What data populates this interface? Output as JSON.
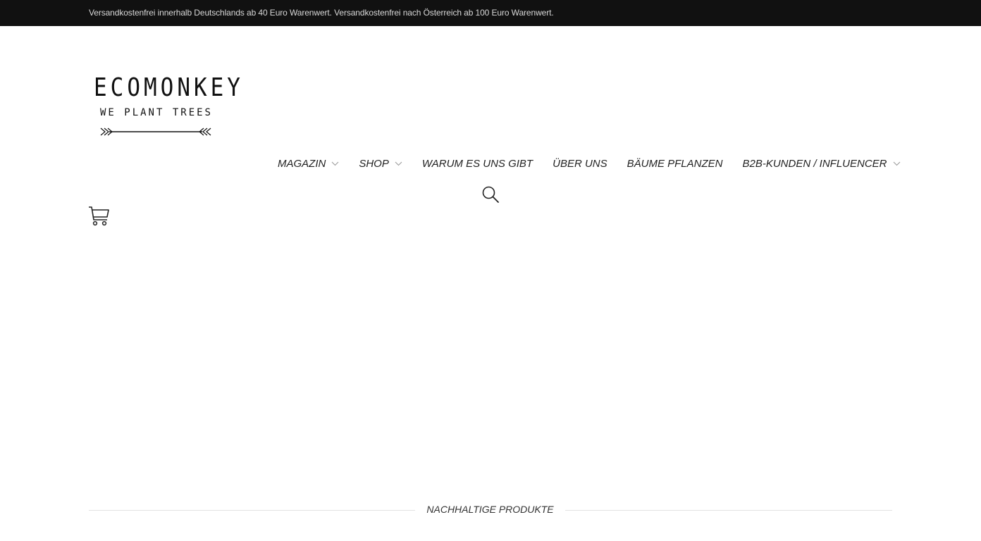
{
  "topbar": {
    "text": "Versandkostenfrei innerhalb Deutschlands ab 40 Euro Warenwert. Versandkostenfrei nach Österreich ab 100 Euro Warenwert."
  },
  "logo": {
    "title": "ECOMONKEY",
    "subtitle": "WE PLANT TREES"
  },
  "nav": {
    "items": [
      {
        "label": "MAGAZIN",
        "has_dropdown": true
      },
      {
        "label": "SHOP",
        "has_dropdown": true
      },
      {
        "label": "WARUM ES UNS GIBT",
        "has_dropdown": false
      },
      {
        "label": "ÜBER UNS",
        "has_dropdown": false
      },
      {
        "label": "BÄUME PFLANZEN",
        "has_dropdown": false
      },
      {
        "label": "B2B-KUNDEN / INFLUENCER",
        "has_dropdown": true
      }
    ]
  },
  "icons": {
    "search": "search-icon",
    "cart": "cart-icon",
    "dropdown": "chevron-down-icon"
  },
  "section": {
    "title": "NACHHALTIGE PRODUKTE"
  },
  "colors": {
    "topbar_bg": "#111111",
    "topbar_text": "#d8d8d8",
    "text": "#222222",
    "divider": "#e3e3e3"
  }
}
